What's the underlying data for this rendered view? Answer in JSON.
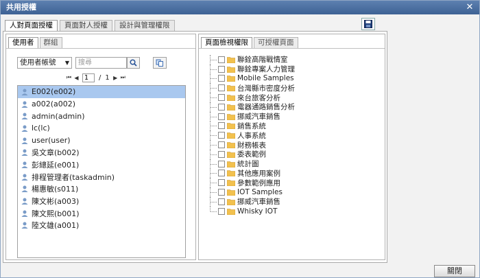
{
  "window": {
    "title": "共用授權"
  },
  "tabs": [
    {
      "label": "人對頁面授權",
      "active": true
    },
    {
      "label": "頁面對人授權",
      "active": false
    },
    {
      "label": "設計與管理權限",
      "active": false
    }
  ],
  "left": {
    "tabs": [
      {
        "label": "使用者",
        "active": true
      },
      {
        "label": "群組",
        "active": false
      }
    ],
    "filter": {
      "selected": "使用者帳號"
    },
    "search": {
      "placeholder": "搜尋"
    },
    "pager": {
      "current_page": "1",
      "separator": "/",
      "total_pages": "1"
    },
    "users": [
      {
        "label": "E002(e002)",
        "selected": true
      },
      {
        "label": "a002(a002)"
      },
      {
        "label": "admin(admin)"
      },
      {
        "label": "lc(lc)"
      },
      {
        "label": "user(user)"
      },
      {
        "label": "吳文章(b002)"
      },
      {
        "label": "彭總延(e001)"
      },
      {
        "label": "排程管理者(taskadmin)"
      },
      {
        "label": "楊惠敏(s011)"
      },
      {
        "label": "陳文彬(a003)"
      },
      {
        "label": "陳文熙(b001)"
      },
      {
        "label": "陸文雄(a001)"
      }
    ]
  },
  "right": {
    "tabs": [
      {
        "label": "頁面檢視權限",
        "active": true
      },
      {
        "label": "可授權頁面",
        "active": false
      }
    ],
    "tree": [
      {
        "label": "聯銓高階戰情室"
      },
      {
        "label": "聯銓專案人力管理"
      },
      {
        "label": "Mobile Samples"
      },
      {
        "label": "台灣縣市密度分析"
      },
      {
        "label": "來台旅客分析"
      },
      {
        "label": "電器通路銷售分析"
      },
      {
        "label": "挪威汽車銷售"
      },
      {
        "label": "銷售系統"
      },
      {
        "label": "人事系統"
      },
      {
        "label": "財務帳表"
      },
      {
        "label": "委表範例"
      },
      {
        "label": "統計圖"
      },
      {
        "label": "其他應用案例"
      },
      {
        "label": "參數範例應用"
      },
      {
        "label": "IOT Samples"
      },
      {
        "label": "挪威汽車銷售"
      },
      {
        "label": "Whisky IOT"
      }
    ]
  },
  "footer": {
    "close_label": "關閉"
  },
  "colors": {
    "title_bar": "#4a6fa5",
    "selected_row": "#a9c8ef",
    "folder": "#f2c14e"
  }
}
